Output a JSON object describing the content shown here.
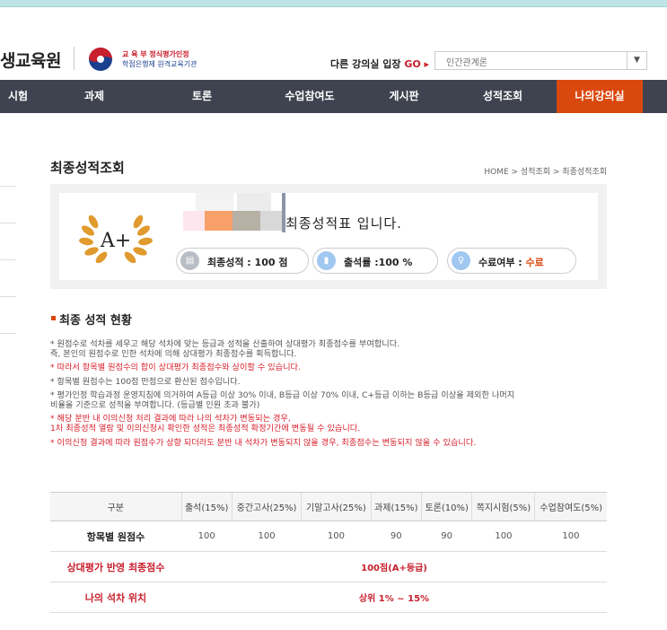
{
  "header": {
    "site_title": "생교육원",
    "org_line1": "교 육 부  정식평가인정",
    "org_line2": "학점은행제 원격교육기관",
    "goto_label": "다른 강의실 입장",
    "goto_go": "GO ▸",
    "course_select_value": "인간관계론",
    "select_arrow": "▼"
  },
  "nav": {
    "items": [
      "시험",
      "과제",
      "토론",
      "수업참여도",
      "게시판",
      "성적조회",
      "나의강의실"
    ],
    "active": "나의강의실",
    "active_color": "#d9480f"
  },
  "page": {
    "title": "최종성적조회",
    "breadcrumb": "HOME > 성적조회 > 최종성적조회"
  },
  "summary": {
    "grade_badge": "A+",
    "title": "최종성적표 입니다.",
    "final_score_label": "최종성적 : 100 점",
    "attendance_label": "출석률 :100 %",
    "completion_label": "수료여부 : ",
    "completion_value": "수료"
  },
  "section": {
    "title": "최종 성적 현황"
  },
  "notes": [
    {
      "text": "* 원점수로 석차를 세우고 해당 석차에 맞는 등급과 성적을 산출하여 상대평가 최종점수를 부여합니다.\n  즉, 본인의 원점수로 인한 석차에 의해 상대평가 최종점수를 획득합니다.",
      "red": false
    },
    {
      "text": "* 따라서 항목별 원점수의 합이 상대평가 최종점수와 상이할 수 있습니다.",
      "red": true
    },
    {
      "text": "* 항목별 원점수는 100점 만점으로 환산된 점수입니다.",
      "red": false
    },
    {
      "text": "* 평가인정 학습과정 운영지침에 의거하여 A등급 이상 30% 이내, B등급 이상 70% 이내, C+등급 이하는 B등급 이상을 제외한 나머지\n  비율을 기준으로 성적을 부여합니다. (등급별 인원 초과 불가)",
      "red": false
    },
    {
      "text": "* 해당 분반 내 이의신청 처리 결과에 따라 나의 석차가 변동되는 경우,\n  1차 최종성적 열람 및 이의신청시 확인한 성적은 최종성적 확정기간에 변동될 수 있습니다.",
      "red": true
    },
    {
      "text": "* 이의신청 결과에 따라 원점수가 상향 되더라도 분반 내 석차가 변동되지 않을 경우, 최종점수는 변동되지 않을 수 있습니다.",
      "red": true
    }
  ],
  "table": {
    "headers": [
      "구분",
      "출석(15%)",
      "중간고사(25%)",
      "기말고사(25%)",
      "과제(15%)",
      "토론(10%)",
      "쪽지시험(5%)",
      "수업참여도(5%)"
    ],
    "raw_label": "항목별 원점수",
    "raw_scores": [
      "100",
      "100",
      "100",
      "90",
      "90",
      "100",
      "100"
    ],
    "final_label": "상대평가 반영 최종점수",
    "final_value": "100점(A+등급)",
    "rank_label": "나의 석차 위치",
    "rank_value": "상위 1% ~ 15%"
  }
}
